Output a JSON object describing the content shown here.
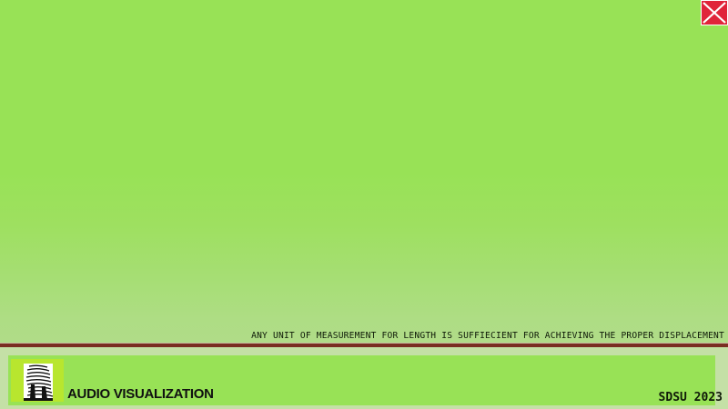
{
  "window": {
    "close_icon": "close-x-icon",
    "close_color": "#e0243a"
  },
  "caption": {
    "text": "ANY UNIT OF MEASUREMENT FOR LENGTH IS SUFFIECIENT FOR ACHIEVING THE PROPER DISPLACEMENT"
  },
  "footer": {
    "logo_icon": "sound-wave-head-icon",
    "logo_text": "AUDIO VISUALIZATION",
    "right_text": "SDSU 2023"
  },
  "colors": {
    "background": "#98e256",
    "divider": "#7a2e22",
    "logo_background": "#b8e62e"
  }
}
